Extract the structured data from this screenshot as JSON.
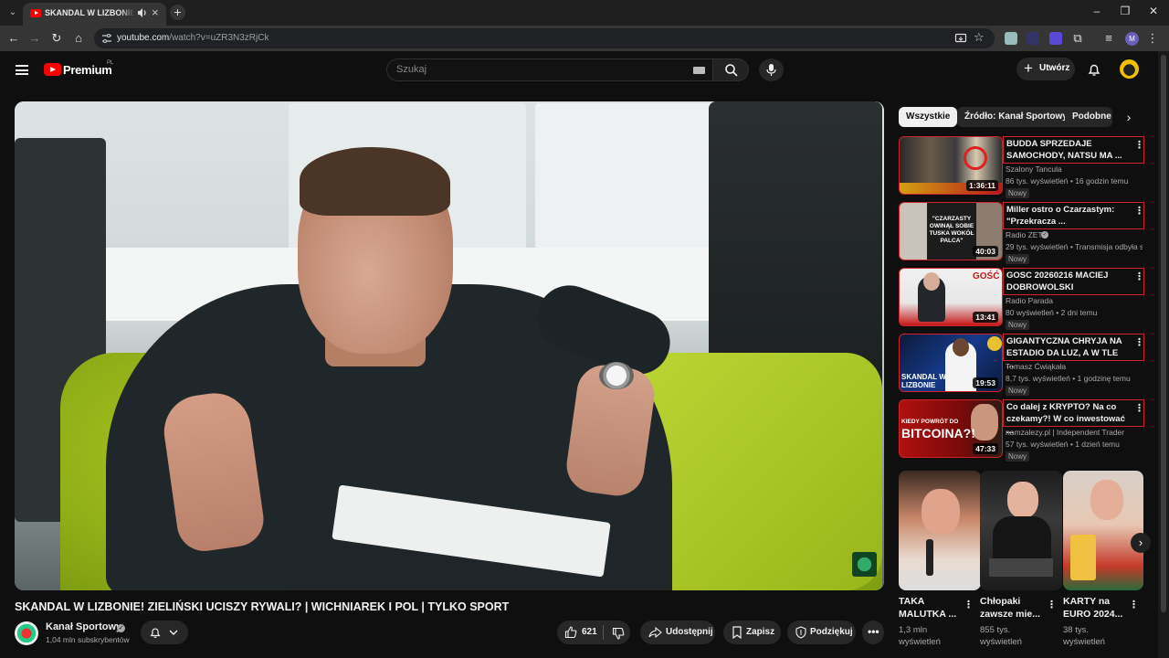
{
  "browser": {
    "tab_title": "SKANDAL W LIZBONIE! ZIELIŃSKI UCISZY RYWALI?",
    "url_host": "youtube.com",
    "url_path": "/watch?v=uZR3N3zRjCk",
    "profile_initial": "M"
  },
  "masthead": {
    "logo_text": "Premium",
    "country": "PL",
    "search_placeholder": "Szukaj",
    "create_label": "Utwórz"
  },
  "video": {
    "title": "SKANDAL W LIZBONIE! ZIELIŃSKI UCISZY RYWALI? | WICHNIAREK I POL | TYLKO SPORT",
    "channel": "Kanał Sportowy",
    "subscribers": "1,04 mln subskrybentów",
    "likes": "621",
    "share_label": "Udostępnij",
    "save_label": "Zapisz",
    "thanks_label": "Podziękuj"
  },
  "chips": [
    "Wszystkie",
    "Źródło: Kanał Sportowy",
    "Podobne"
  ],
  "recommendations": [
    {
      "title": "BUDDA SPRZEDAJE SAMOCHODY, NATSU MA ...",
      "channel": "Szalony Tancula",
      "meta": "86 tys. wyświetleń • 16 godzin temu",
      "badge": "Nowy",
      "duration": "1:36:11"
    },
    {
      "title": "Miller ostro o Czarzastym: \"Przekracza ...",
      "channel": "Radio ZET",
      "meta": "29 tys. wyświetleń • Transmisja odbyła s...",
      "badge": "Nowy",
      "duration": "40:03"
    },
    {
      "title": "GOSC 20260216 MACIEJ DOBROWOLSKI",
      "channel": "Radio Parada",
      "meta": "80 wyświetleń • 2 dni temu",
      "badge": "Nowy",
      "duration": "13:41"
    },
    {
      "title": "GIGANTYCZNA CHRYJA NA ESTADIO DA LUZ, A W TLE ...",
      "channel": "Tomasz Ćwiąkała",
      "meta": "8,7 tys. wyświetleń • 1 godzinę temu",
      "badge": "Nowy",
      "duration": "19:53"
    },
    {
      "title": "Co dalej z KRYPTO? Na co czekamy?! W co inwestować ...",
      "channel": "namzalezy.pl | Independent Trader",
      "meta": "57 tys. wyświetleń • 1 dzień temu",
      "badge": "Nowy",
      "duration": "47:33"
    }
  ],
  "thumb_text": {
    "r2": "\"CZARZASTY OWINĄŁ SOBIE TUSKA WOKÓŁ PALCA\"",
    "r3": "GOŚĆ",
    "r4": "SKANDAL W LIZBONIE",
    "r5_top": "KIEDY POWRÓT DO",
    "r5_big": "BITCOINA?!"
  },
  "shorts": [
    {
      "title": "TAKA MALUTKA ...",
      "views": "1,3 mln wyświetleń"
    },
    {
      "title": "Chłopaki zawsze mie...",
      "views": "855 tys. wyświetleń"
    },
    {
      "title": "KARTY na EURO 2024...",
      "views": "38 tys. wyświetleń"
    }
  ]
}
